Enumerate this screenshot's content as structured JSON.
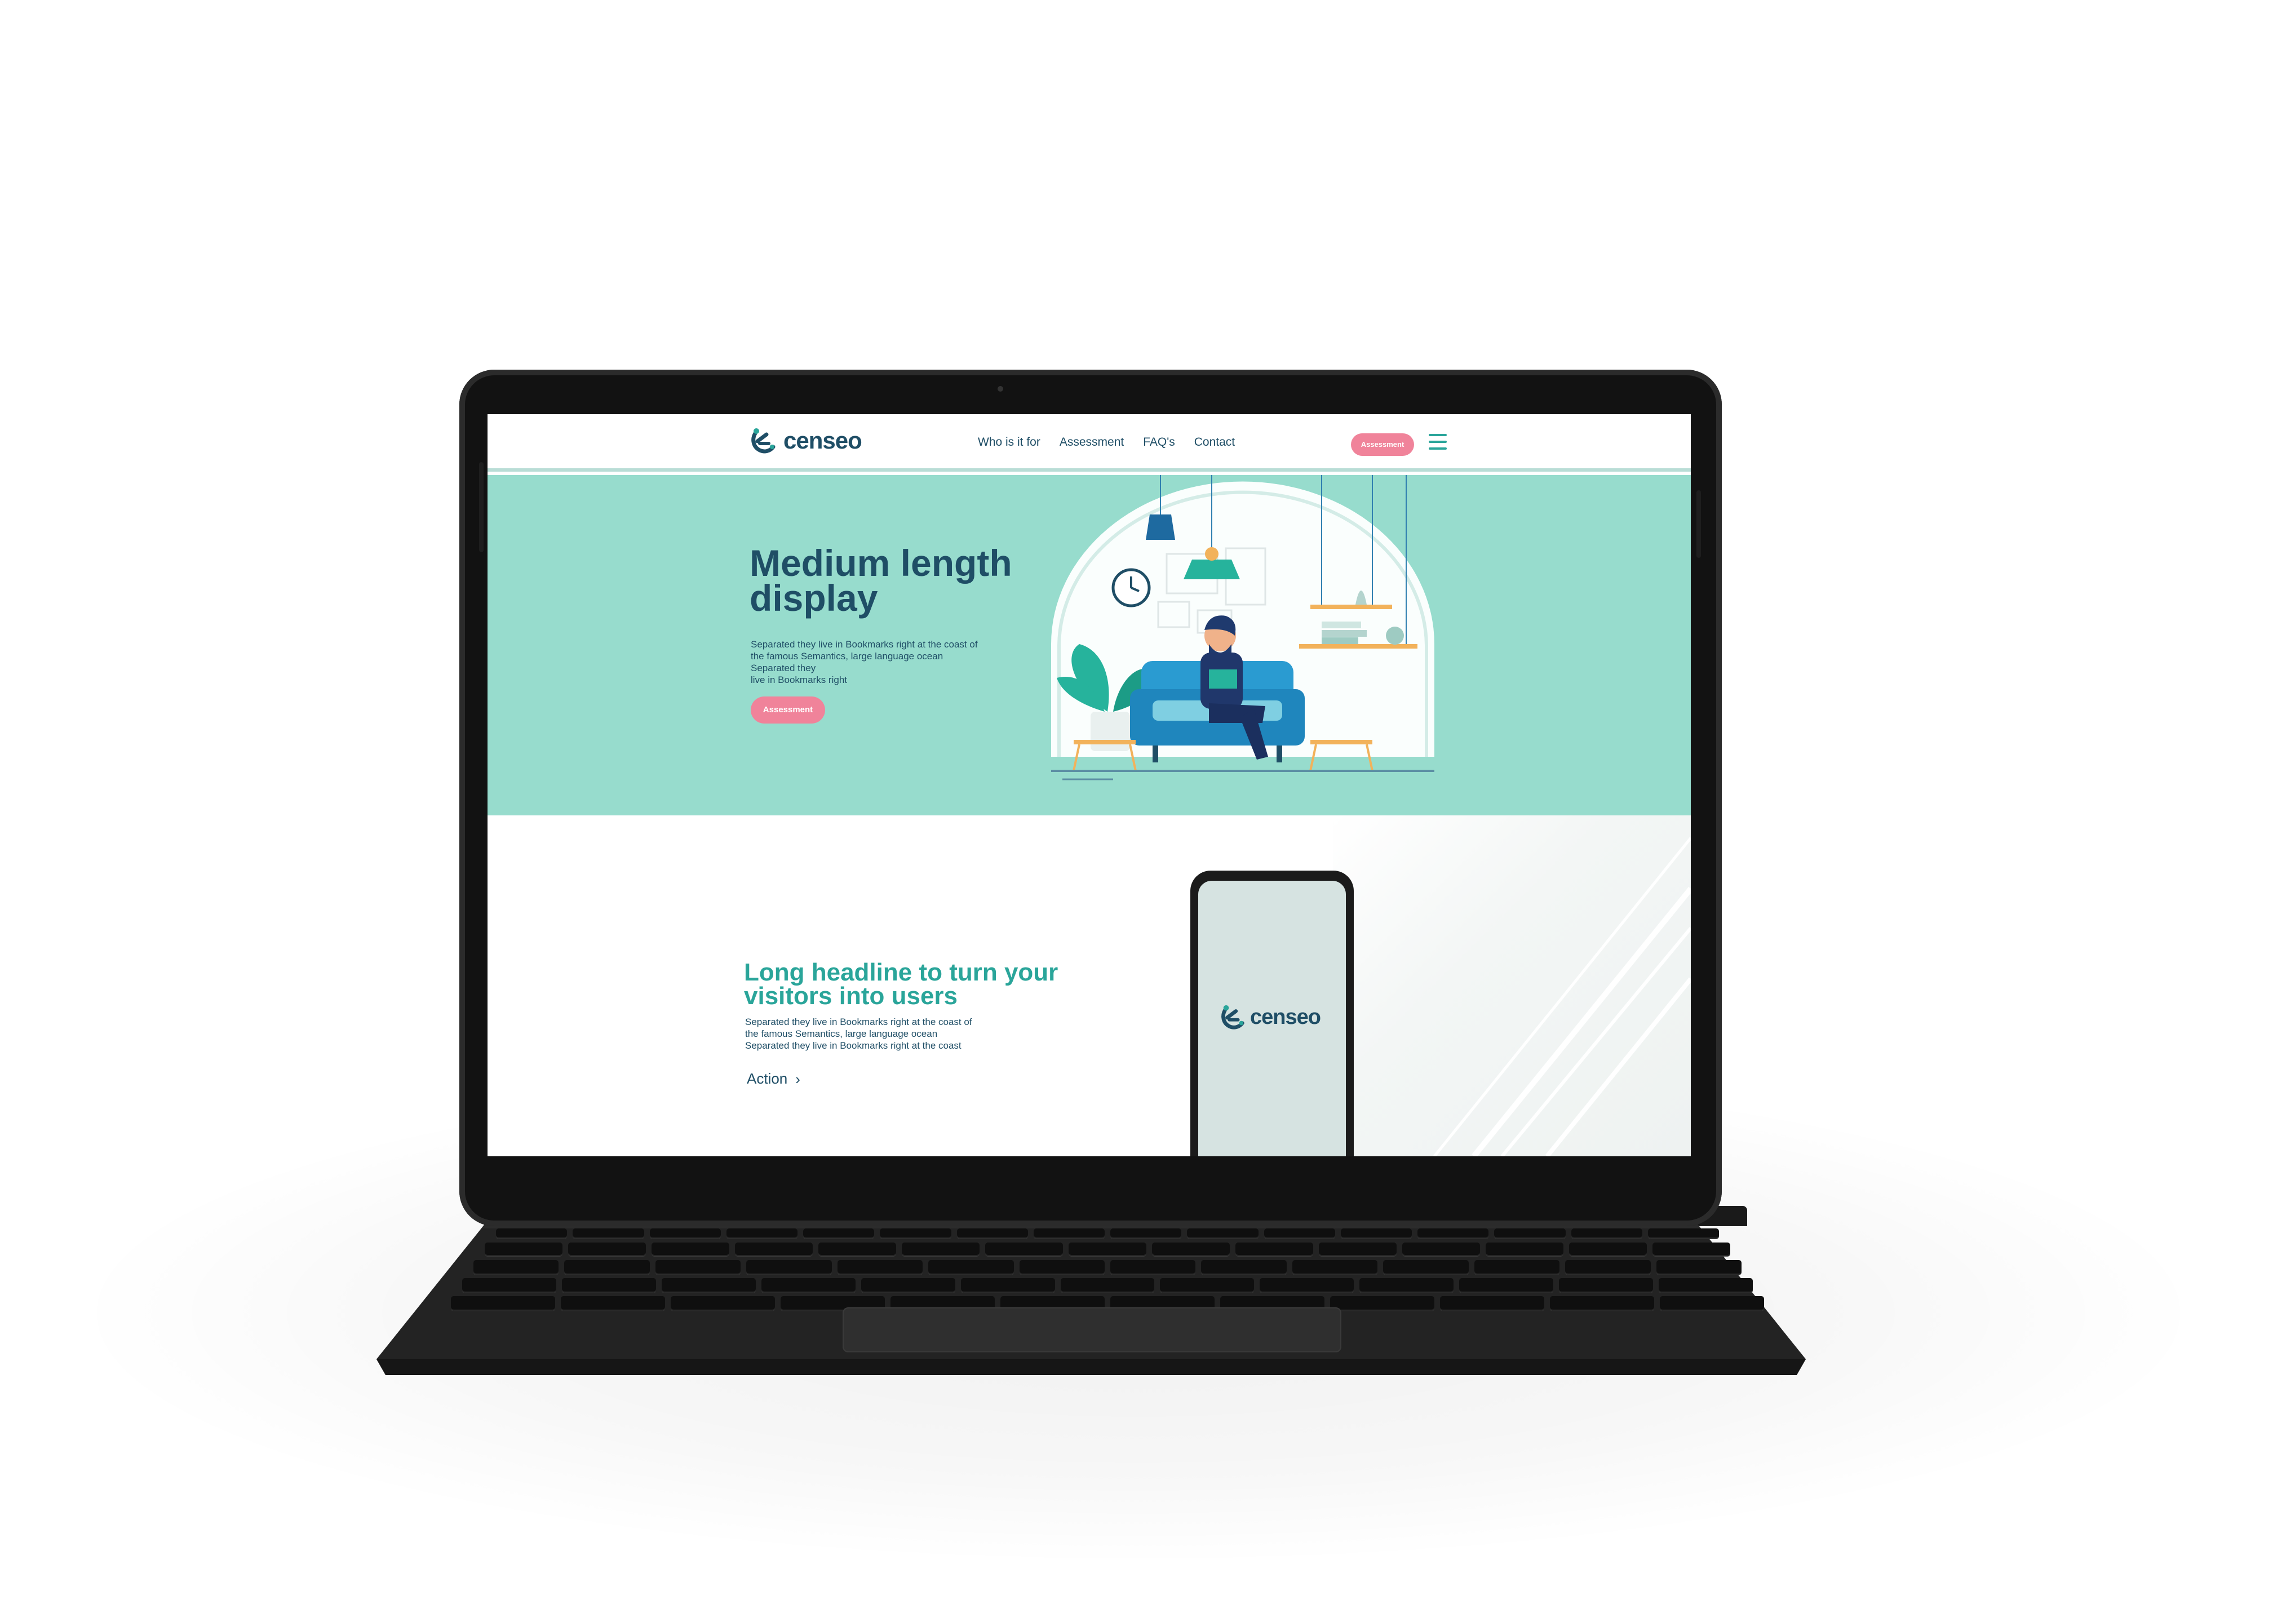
{
  "site": {
    "logo_text": "censeo",
    "nav": {
      "links": [
        "Who is it for",
        "Assessment",
        "FAQ's",
        "Contact"
      ],
      "cta_label": "Assessment"
    },
    "hero": {
      "title": "Medium length display",
      "subtitle_lines": [
        "Separated they live in Bookmarks right at the coast of",
        "the famous Semantics, large language ocean",
        "Separated they",
        "live in Bookmarks right"
      ],
      "button_label": "Assessment"
    },
    "feature": {
      "title": "Long headline to turn your visitors into users",
      "subtitle_lines": [
        "Separated they live in Bookmarks right at the coast of",
        "the famous Semantics, large language ocean",
        "Separated they live in Bookmarks right at the coast"
      ],
      "action_label": "Action",
      "action_icon": "chevron-right-icon"
    },
    "phone": {
      "logo_text": "censeo"
    }
  },
  "colors": {
    "brand_dark": "#1f4e66",
    "brand_teal": "#2aa59a",
    "hero_bg": "#97dccd",
    "cta_pink": "#f0839a",
    "phone_screen": "#d6e3e1"
  }
}
